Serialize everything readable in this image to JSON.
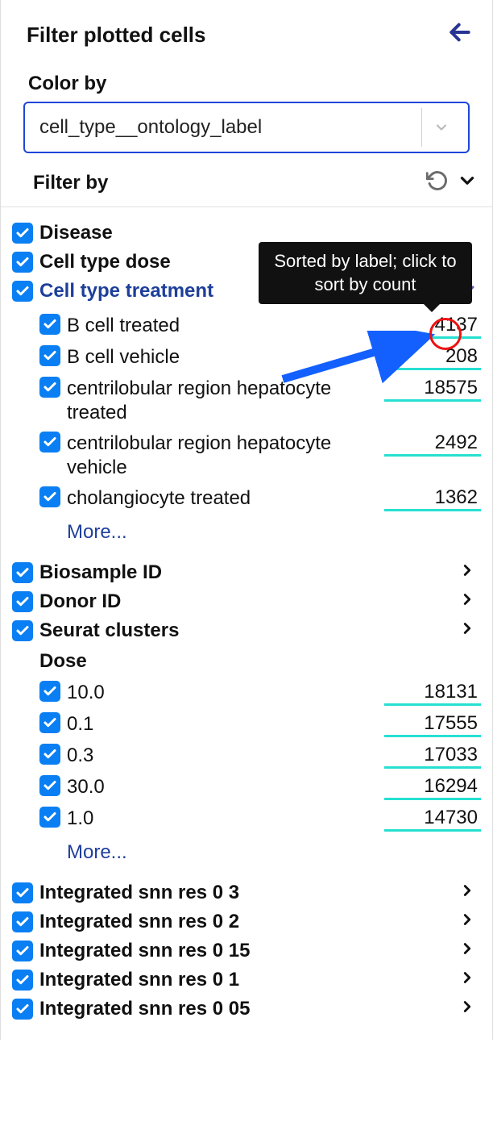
{
  "header": {
    "title": "Filter plotted cells"
  },
  "color_by": {
    "label": "Color by",
    "value": "cell_type__ontology_label"
  },
  "filter_by": {
    "label": "Filter by"
  },
  "tooltip": {
    "text": "Sorted by label; click to sort by count"
  },
  "groups": {
    "disease": {
      "label": "Disease"
    },
    "cell_type_dose": {
      "label": "Cell type dose"
    },
    "cell_type_treatment": {
      "label": "Cell type treatment",
      "items": [
        {
          "label": "B cell treated",
          "count": "4137"
        },
        {
          "label": "B cell vehicle",
          "count": "208"
        },
        {
          "label": "centrilobular region hepatocyte treated",
          "count": "18575"
        },
        {
          "label": "centrilobular region hepatocyte vehicle",
          "count": "2492"
        },
        {
          "label": "cholangiocyte treated",
          "count": "1362"
        }
      ],
      "more": "More..."
    },
    "biosample_id": {
      "label": "Biosample ID"
    },
    "donor_id": {
      "label": "Donor ID"
    },
    "seurat_clusters": {
      "label": "Seurat clusters"
    },
    "dose": {
      "label": "Dose",
      "items": [
        {
          "label": "10.0",
          "count": "18131"
        },
        {
          "label": "0.1",
          "count": "17555"
        },
        {
          "label": "0.3",
          "count": "17033"
        },
        {
          "label": "30.0",
          "count": "16294"
        },
        {
          "label": "1.0",
          "count": "14730"
        }
      ],
      "more": "More..."
    },
    "snn_03": {
      "label": "Integrated snn res 0 3"
    },
    "snn_02": {
      "label": "Integrated snn res 0 2"
    },
    "snn_015": {
      "label": "Integrated snn res 0 15"
    },
    "snn_01": {
      "label": "Integrated snn res 0 1"
    },
    "snn_005": {
      "label": "Integrated snn res 0 05"
    }
  }
}
